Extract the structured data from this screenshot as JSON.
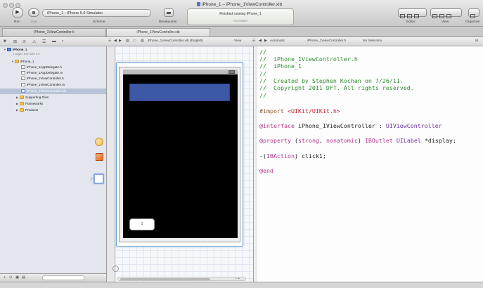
{
  "window": {
    "title": "iPhone_1 – iPhone_1ViewController.xib"
  },
  "toolbar": {
    "run_label": "Run",
    "stop_label": "Stop",
    "scheme_label": "Scheme",
    "scheme_value": "iPhone_1 › iPhone 5.0 Simulator",
    "breakpoints_label": "Breakpoints",
    "activity_line1": "Finished running iPhone_1",
    "activity_line2": "No Issues",
    "editor_label": "Editor",
    "view_label": "View",
    "organizer_label": "Organizer"
  },
  "tabs": [
    {
      "label": "iPhone_1ViewController.h"
    },
    {
      "label": "iPhone_1ViewController.xib"
    }
  ],
  "navigator": {
    "project_name": "iPhone_1",
    "project_subtitle": "1 target, iOS SDK 5.0",
    "items": [
      {
        "label": "iPhone_1"
      },
      {
        "label": "iPhone_1AppDelegate.h"
      },
      {
        "label": "iPhone_1AppDelegate.m"
      },
      {
        "label": "iPhone_1ViewController.h"
      },
      {
        "label": "iPhone_1ViewController.m"
      },
      {
        "label": "iPhone_1ViewController.xib"
      },
      {
        "label": "Supporting Files"
      },
      {
        "label": "Frameworks"
      },
      {
        "label": "Products"
      }
    ]
  },
  "jumpbar": {
    "ib_path": "iPhone_1ViewController.xib (English)",
    "ib_view": "View",
    "mode": "Automatic",
    "editor_path": "iPhone_1ViewController.h",
    "selection": "No Selection"
  },
  "ib": {
    "button_title": "1"
  },
  "code": {
    "lines": [
      "//",
      "//  iPhone_1ViewController.h",
      "//  iPhone_1",
      "//",
      "//  Created by Stephen Kochan on 7/26/11.",
      "//  Copyright 2011 DFT. All rights reserved.",
      "//"
    ],
    "import_kw": "#import",
    "import_str": "<UIKit/UIKit.h>",
    "interface_kw": "@interface",
    "interface_name": " iPhone_1ViewController : ",
    "interface_super": "UIViewController",
    "property_kw": "@property",
    "property_open": " (",
    "property_strong": "strong",
    "property_comma": ", ",
    "property_nonatomic": "nonatomic",
    "property_close": ") ",
    "property_outlet": "IBOutlet",
    "property_space": " ",
    "property_type": "UILabel",
    "property_rest": " *display;",
    "action_open": "-(",
    "action_kw": "IBAction",
    "action_rest": ") click1;",
    "end_kw": "@end"
  }
}
